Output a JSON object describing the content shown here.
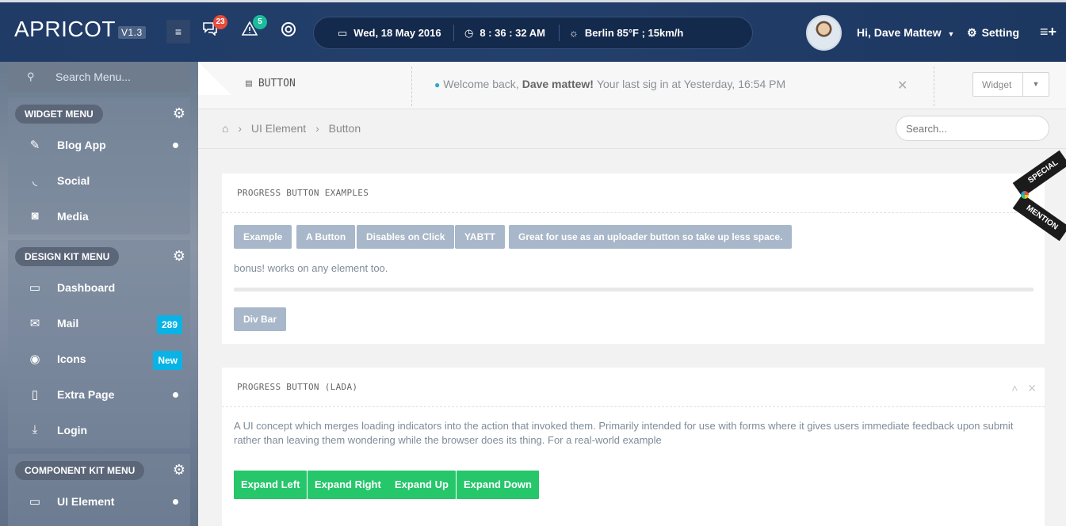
{
  "topbar": {
    "brand": "APRICOT",
    "version": "V1.3",
    "menu_icon": "hamburger-icon",
    "messages_badge": "23",
    "alerts_badge": "5",
    "date": "Wed, 18 May 2016",
    "time": "8 : 36 : 32 AM",
    "weather": "Berlin  85°F ; 15km/h",
    "user_greeting": "Hi, Dave Mattew",
    "setting_label": "Setting",
    "colors": {
      "messages_badge": "#e74c3c",
      "alerts_badge": "#1abc9c"
    }
  },
  "sidebar": {
    "search_placeholder": "Search Menu...",
    "groups": [
      {
        "title": "WIDGET MENU",
        "items": [
          {
            "label": "Blog App",
            "icon": "edit-icon"
          },
          {
            "label": "Social",
            "icon": "rss-icon"
          },
          {
            "label": "Media",
            "icon": "camera-icon"
          }
        ]
      },
      {
        "title": "DESIGN KIT MENU",
        "items": [
          {
            "label": "Dashboard",
            "icon": "window-icon"
          },
          {
            "label": "Mail",
            "icon": "mail-icon",
            "badge": "289"
          },
          {
            "label": "Icons",
            "icon": "eye-icon",
            "badge": "New"
          },
          {
            "label": "Extra Page",
            "icon": "file-icon"
          },
          {
            "label": "Login",
            "icon": "download-icon"
          }
        ]
      },
      {
        "title": "COMPONENT KIT MENU",
        "items": [
          {
            "label": "UI Element",
            "icon": "monitor-icon"
          }
        ]
      }
    ]
  },
  "header": {
    "page_label": "BUTTON",
    "welcome_prefix": "Welcome back,",
    "welcome_name": "Dave mattew!",
    "welcome_suffix": "Your last sig in at Yesterday, 16:54 PM",
    "widget_label": "Widget"
  },
  "breadcrumb": {
    "items": [
      "UI Element",
      "Button"
    ],
    "search_placeholder": "Search..."
  },
  "ribbon": {
    "line1": "SPECIAL",
    "line2": "MENTION"
  },
  "panel1": {
    "title": "PROGRESS BUTTON EXAMPLES",
    "buttons": [
      "Example",
      "A Button",
      "Disables on Click",
      "YABTT",
      "Great for use as an uploader button so take up less space."
    ],
    "note": "bonus! works on any element too.",
    "div_bar": "Div Bar"
  },
  "panel2": {
    "title": "PROGRESS BUTTON (LADA)",
    "description_line1": "A UI concept which merges loading indicators into the action that invoked them. Primarily intended for use with forms where it gives users immediate feedback upon submit",
    "description_line2": "rather than leaving them wondering while the browser does its thing. For a real-world example",
    "buttons": [
      "Expand Left",
      "Expand Right",
      "Expand Up",
      "Expand Down"
    ]
  }
}
